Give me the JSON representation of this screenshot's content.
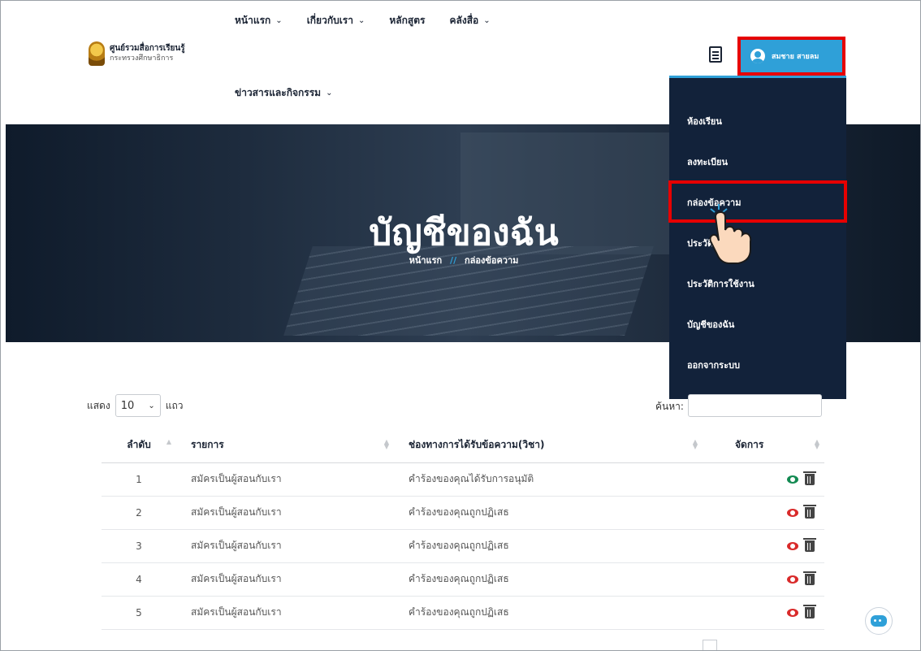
{
  "header": {
    "logo_title": "ศูนย์รวมสื่อการเรียนรู้",
    "logo_sub": "กระทรวงศึกษาธิการ",
    "nav": [
      {
        "label": "หน้าแรก"
      },
      {
        "label": "เกี่ยวกับเรา"
      },
      {
        "label": "หลักสูตร"
      },
      {
        "label": "คลังสื่อ"
      }
    ],
    "nav_second": "ข่าวสารและกิจกรรม",
    "user_name": "สมชาย สายลม"
  },
  "hero": {
    "title": "บัญชีของฉัน",
    "crumb_home": "หน้าแรก",
    "crumb_sep": "//",
    "crumb_current": "กล่องข้อความ"
  },
  "dropdown": {
    "items": [
      "ห้องเรียน",
      "ลงทะเบียน",
      "กล่องข้อความ",
      "ประวัติการเรียน",
      "ประวัติการใช้งาน",
      "บัญชีของฉัน",
      "ออกจากระบบ"
    ]
  },
  "table_controls": {
    "show_label": "แสดง",
    "page_size": "10",
    "rows_label": "แถว",
    "search_label": "ค้นหา:",
    "search_value": ""
  },
  "table": {
    "headers": [
      "ลำดับ",
      "รายการ",
      "ช่องทางการได้รับข้อความ(วิชา)",
      "จัดการ"
    ],
    "rows": [
      {
        "no": "1",
        "item": "สมัครเป็นผู้สอนกับเรา",
        "channel": "คำร้องของคุณได้รับการอนุมัติ",
        "status": "approved"
      },
      {
        "no": "2",
        "item": "สมัครเป็นผู้สอนกับเรา",
        "channel": "คำร้องของคุณถูกปฏิเสธ",
        "status": "rejected"
      },
      {
        "no": "3",
        "item": "สมัครเป็นผู้สอนกับเรา",
        "channel": "คำร้องของคุณถูกปฏิเสธ",
        "status": "rejected"
      },
      {
        "no": "4",
        "item": "สมัครเป็นผู้สอนกับเรา",
        "channel": "คำร้องของคุณถูกปฏิเสธ",
        "status": "rejected"
      },
      {
        "no": "5",
        "item": "สมัครเป็นผู้สอนกับเรา",
        "channel": "คำร้องของคุณถูกปฏิเสธ",
        "status": "rejected"
      }
    ]
  },
  "colors": {
    "accent": "#2fa0d8",
    "highlight": "#e60000",
    "dropdown_bg": "#12223a",
    "eye_approved": "#138a52",
    "eye_rejected": "#d92a2a"
  }
}
